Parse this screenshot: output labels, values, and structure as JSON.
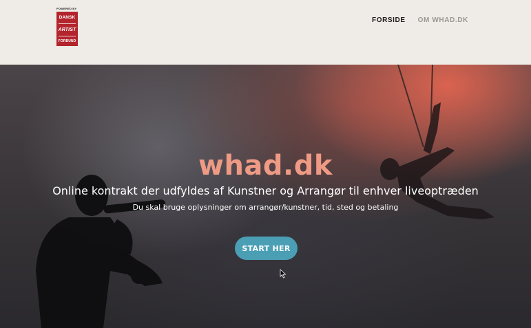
{
  "header": {
    "logo": {
      "powered_by": "POWERED BY",
      "line1": "DANSK",
      "line2": "ARTIST",
      "line3": "FORBUND",
      "color": "#b3242d"
    },
    "nav": [
      {
        "label": "FORSIDE",
        "active": true
      },
      {
        "label": "OM WHAD.DK",
        "active": false
      }
    ]
  },
  "hero": {
    "title": "whad.dk",
    "subtitle": "Online kontrakt der udfyldes af Kunstner og Arrangør til enhver liveoptræden",
    "description": "Du skal bruge oplysninger om arrangør/kunstner, tid, sted og betaling",
    "cta_label": "START HER",
    "title_color": "#ee9a85",
    "cta_color": "#4a9fb5"
  }
}
